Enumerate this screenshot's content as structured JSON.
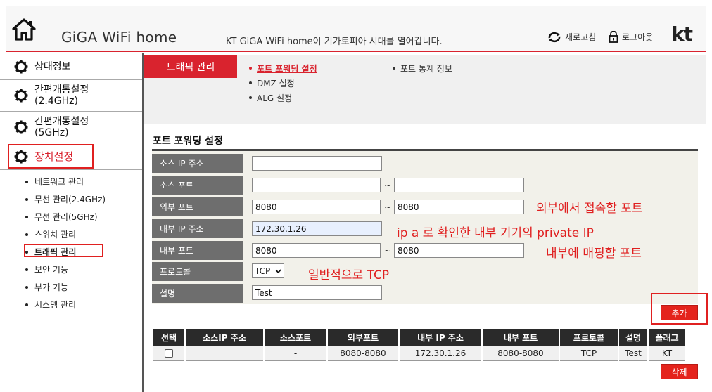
{
  "header": {
    "brand": "GiGA WiFi home",
    "tagline": "KT GiGA WiFi home이 기가토피아 시대를 열어갑니다.",
    "refresh_label": "새로고침",
    "logout_label": "로그아웃",
    "logo_text": "kt"
  },
  "sidebar": {
    "main": [
      {
        "label": "상태정보"
      },
      {
        "label": "간편개통설정\n(2.4GHz)"
      },
      {
        "label": "간편개통설정\n(5GHz)"
      },
      {
        "label": "장치설정"
      }
    ],
    "sub": [
      {
        "label": "네트워크 관리"
      },
      {
        "label": "무선 관리(2.4GHz)"
      },
      {
        "label": "무선 관리(5GHz)"
      },
      {
        "label": "스위치 관리"
      },
      {
        "label": "트래픽 관리"
      },
      {
        "label": "보안 기능"
      },
      {
        "label": "부가 기능"
      },
      {
        "label": "시스템 관리"
      }
    ]
  },
  "tabs": {
    "title": "트래픽 관리",
    "links": [
      {
        "label": "포트 포워딩 설정"
      },
      {
        "label": "DMZ 설정"
      },
      {
        "label": "ALG 설정"
      },
      {
        "label": "포트 통계 정보"
      }
    ]
  },
  "form": {
    "title": "포트 포워딩 설정",
    "labels": {
      "source_ip": "소스 IP 주소",
      "source_port": "소스 포트",
      "external_port": "외부 포트",
      "internal_ip": "내부 IP 주소",
      "internal_port": "내부 포트",
      "protocol": "프로토콜",
      "description": "설명"
    },
    "values": {
      "source_ip": "",
      "source_port_from": "",
      "source_port_to": "",
      "external_port_from": "8080",
      "external_port_to": "8080",
      "internal_ip": "172.30.1.26",
      "internal_port_from": "8080",
      "internal_port_to": "8080",
      "protocol": "TCP",
      "description": "Test"
    },
    "tilde": "~",
    "add_button": "추가"
  },
  "annotations": {
    "external_port": "외부에서 접속할 포트",
    "internal_ip": "ip a 로 확인한 내부 기기의 private IP",
    "internal_port": "내부에 매핑할 포트",
    "protocol": "일반적으로 TCP"
  },
  "table": {
    "headers": [
      "선택",
      "소스IP 주소",
      "소스포트",
      "외부포트",
      "내부 IP 주소",
      "내부 포트",
      "프로토콜",
      "설명",
      "플래그"
    ],
    "rows": [
      [
        "",
        "",
        "-",
        "8080-8080",
        "172.30.1.26",
        "8080-8080",
        "TCP",
        "Test",
        "KT"
      ]
    ],
    "delete_button": "삭제"
  },
  "colors": {
    "accent": "#d9232e",
    "annotation": "#e02020",
    "label_bg": "#6e6e6e",
    "table_header_bg": "#2a2a2a"
  }
}
